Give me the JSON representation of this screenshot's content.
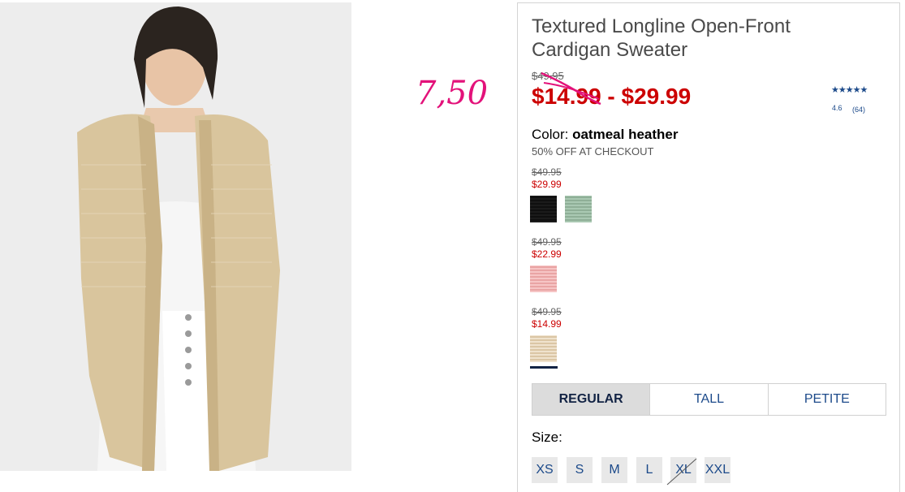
{
  "annotation": "7,50",
  "product": {
    "title": "Textured Longline Open-Front Cardigan Sweater",
    "was_price": "$49.95",
    "price_range": "$14.99 - $29.99",
    "rating_stars": "★★★★★",
    "rating_value": "4.6",
    "rating_count": "(64)"
  },
  "color": {
    "label": "Color:",
    "selected": "oatmeal heather",
    "promo": "50% OFF AT CHECKOUT"
  },
  "swatch_groups": [
    {
      "was": "$49.95",
      "now": "$29.99",
      "swatches": [
        "black",
        "sage-green"
      ]
    },
    {
      "was": "$49.95",
      "now": "$22.99",
      "swatches": [
        "pink"
      ]
    },
    {
      "was": "$49.95",
      "now": "$14.99",
      "swatches": [
        "oatmeal-heather"
      ]
    }
  ],
  "fit_tabs": [
    "REGULAR",
    "TALL",
    "PETITE"
  ],
  "size": {
    "label": "Size:",
    "options": [
      "XS",
      "S",
      "M",
      "L",
      "XL",
      "XXL"
    ],
    "unavailable": "XL"
  },
  "colors": {
    "sale_red": "#cc0000",
    "link_blue": "#1c4a8a",
    "annotation_pink": "#e3127a"
  }
}
